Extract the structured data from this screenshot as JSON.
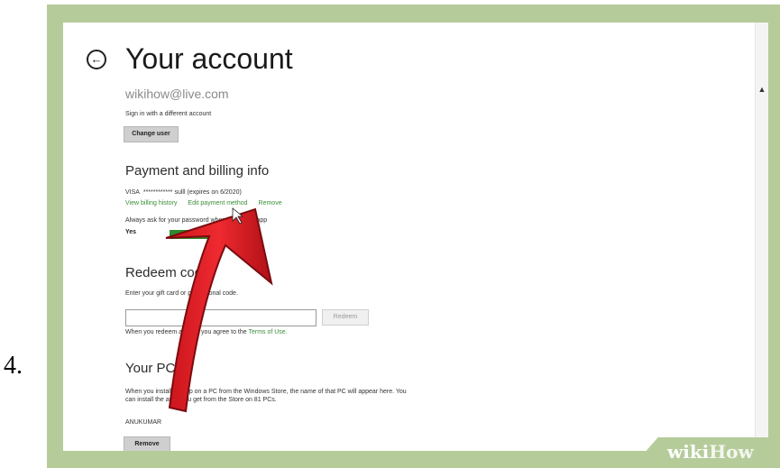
{
  "step": {
    "number": "4."
  },
  "header": {
    "title": "Your account"
  },
  "account": {
    "email": "wikihow@live.com",
    "sign_in_text": "Sign in with a different account",
    "change_user_label": "Change user"
  },
  "payment": {
    "title": "Payment and billing info",
    "card_brand": "VISA",
    "card_number": "************ sulll",
    "card_expiry": "(expires on 6/2020)",
    "links": [
      "View billing history",
      "Edit payment method",
      "Remove"
    ],
    "always_ask_text": "Always ask for your password when buying an app",
    "toggle_label": "Yes",
    "toggle_on": true
  },
  "redeem": {
    "title": "Redeem code",
    "instructions": "Enter your gift card or promotional code.",
    "input_value": "",
    "button_label": "Redeem",
    "terms_prefix": "When you redeem a code, you agree to the ",
    "terms_link": "Terms of Use."
  },
  "pcs": {
    "title": "Your PCs",
    "description": "When you install an app on a PC from the Windows Store, the name of that PC will appear here. You can install the apps you get from the Store on 81 PCs.",
    "pc_name": "ANUKUMAR",
    "remove_label": "Remove"
  },
  "watermark": {
    "wiki": "wiki",
    "how": "How"
  },
  "colors": {
    "frame": "#b5cc9a",
    "link": "#3a8d3a",
    "toggle": "#2e8a2e",
    "arrow": "#e31e24"
  }
}
